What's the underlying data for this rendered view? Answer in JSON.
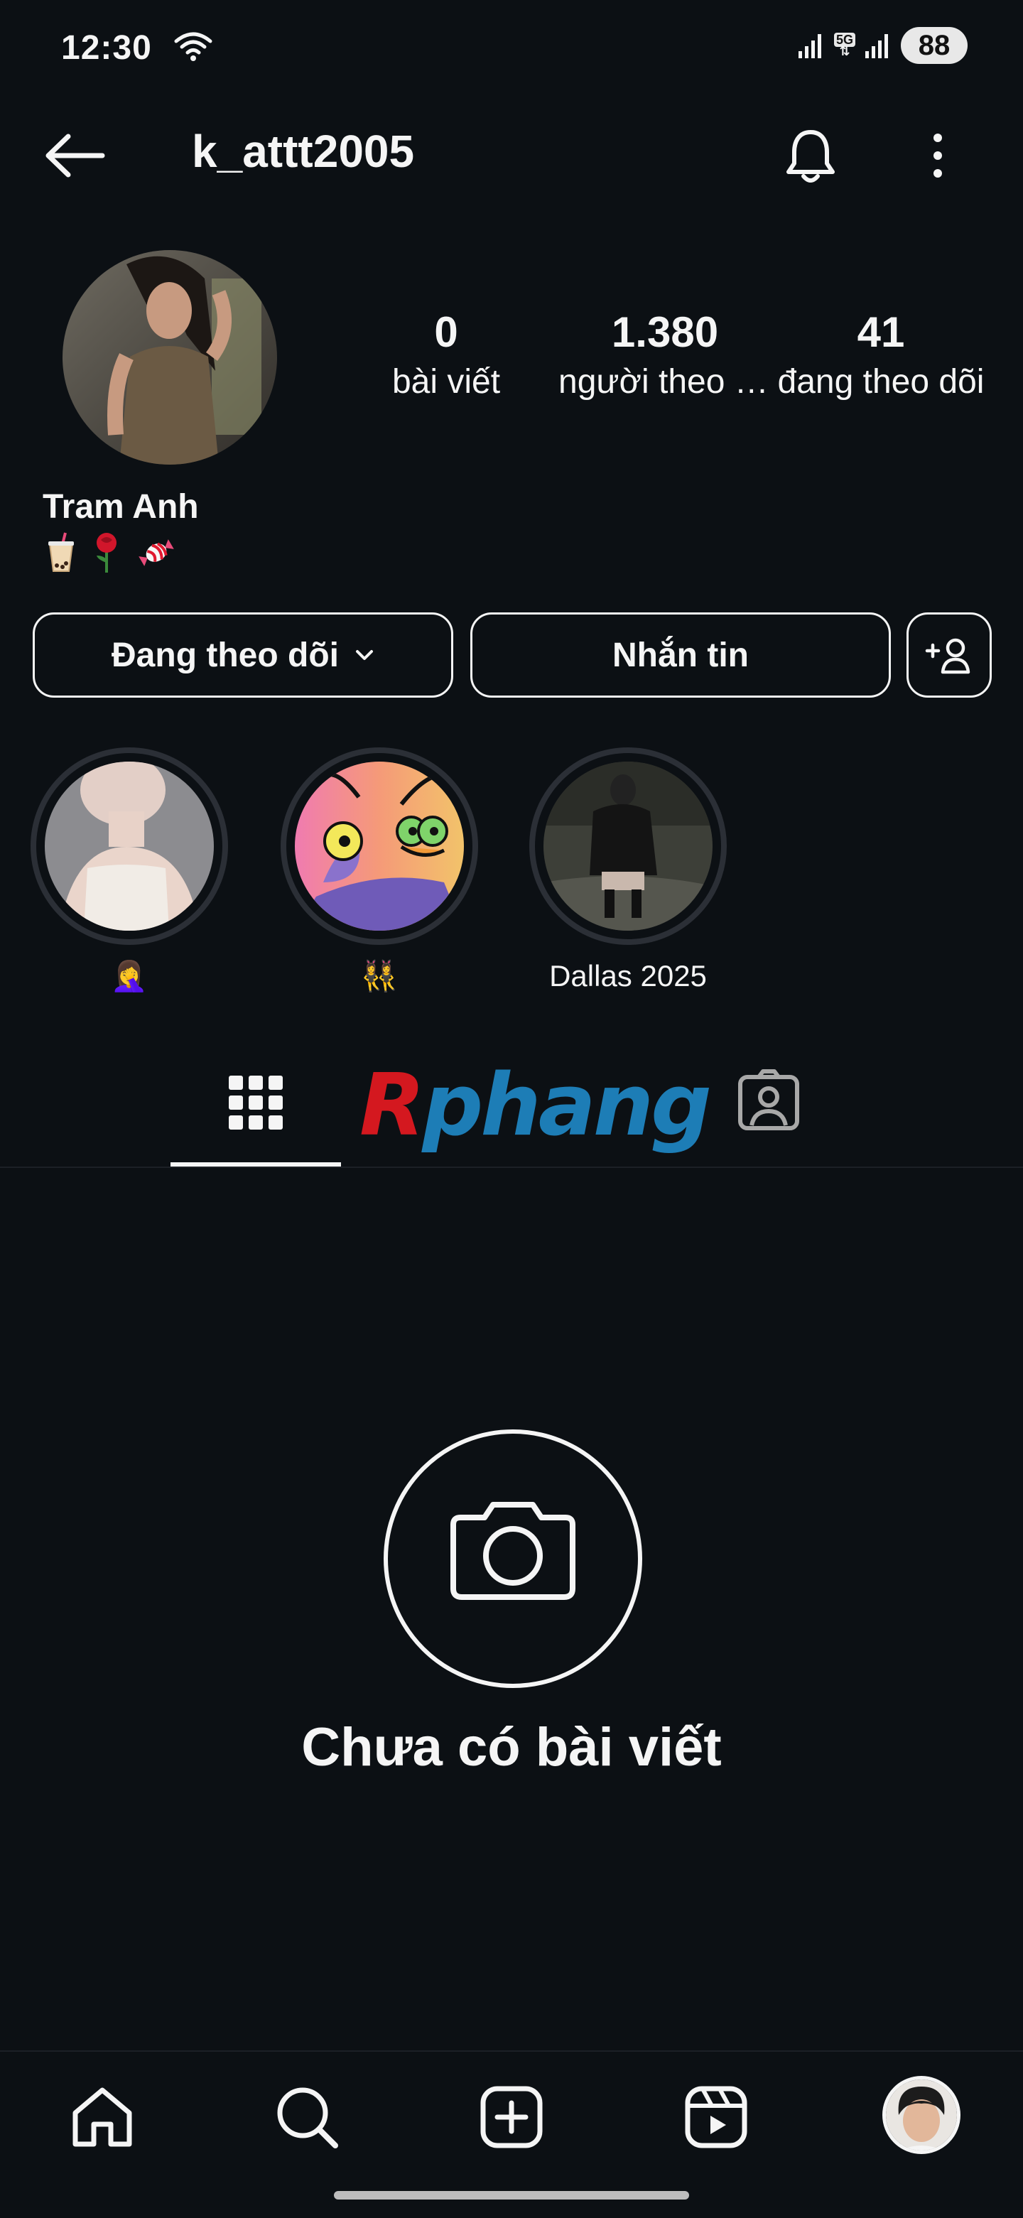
{
  "status_bar": {
    "time": "12:30",
    "network": "5G",
    "battery": "88"
  },
  "header": {
    "username": "k_attt2005"
  },
  "profile": {
    "display_name": "Tram Anh",
    "bio_emojis": "🧋🌹🍬",
    "stats": [
      {
        "value": "0",
        "label": "bài viết"
      },
      {
        "value": "1.380",
        "label": "người theo dõi"
      },
      {
        "value": "41",
        "label": "đang theo dõi"
      }
    ]
  },
  "actions": {
    "follow_label": "Đang theo dõi",
    "message_label": "Nhắn tin"
  },
  "highlights": [
    {
      "caption": "🤦‍♀️"
    },
    {
      "caption": "👯‍♀️"
    },
    {
      "caption": "Dallas 2025"
    }
  ],
  "watermark": {
    "first_letter": "R",
    "rest": "phang"
  },
  "empty_state": {
    "text": "Chưa có bài viết"
  },
  "colors": {
    "background": "#0c1014",
    "foreground": "#f5f5f5",
    "divider": "#1c2026"
  }
}
